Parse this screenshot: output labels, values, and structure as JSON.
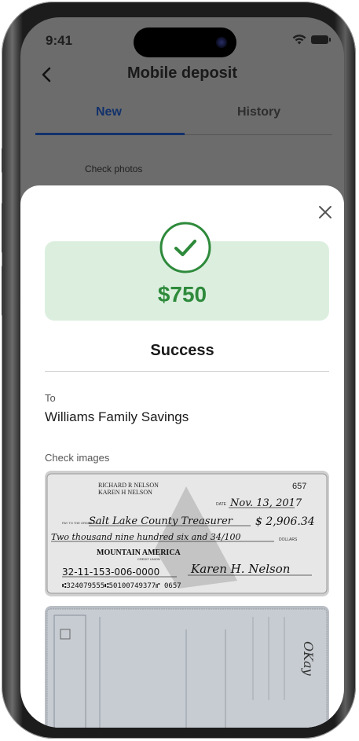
{
  "status_bar": {
    "time": "9:41"
  },
  "header": {
    "title": "Mobile deposit"
  },
  "tabs": [
    {
      "label": "New"
    },
    {
      "label": "History"
    }
  ],
  "background": {
    "section_label": "Check photos"
  },
  "modal": {
    "amount": "$750",
    "status": "Success",
    "to_label": "To",
    "to_value": "Williams Family Savings",
    "images_label": "Check images"
  },
  "check_front": {
    "payer_name_1": "RICHARD R NELSON",
    "payer_name_2": "KAREN H NELSON",
    "check_number": "657",
    "date_label": "DATE",
    "date": "Nov. 13, 2017",
    "pay_to_label": "PAY TO THE ORDER OF",
    "payee": "Salt Lake County Treasurer",
    "amount_numeric": "$ 2,906.34",
    "amount_words": "Two thousand nine hundred six and 34/100",
    "dollars_label": "DOLLARS",
    "bank_name": "MOUNTAIN AMERICA",
    "bank_sub": "CREDIT UNION",
    "memo": "32-11-153-006-0000",
    "signature": "Karen H. Nelson",
    "micr": "⑆324079555⑆50100749377⑈ 0657"
  },
  "check_back": {
    "endorsement": "OKay"
  },
  "colors": {
    "accent": "#12316b",
    "success_green": "#2e8a3b",
    "success_bg": "#dcefdf",
    "overlay": "#6c6c6c"
  },
  "icons": {
    "back": "chevron-left-icon",
    "close": "close-icon",
    "success": "check-circle-icon",
    "wifi": "wifi-icon",
    "battery": "battery-icon"
  }
}
